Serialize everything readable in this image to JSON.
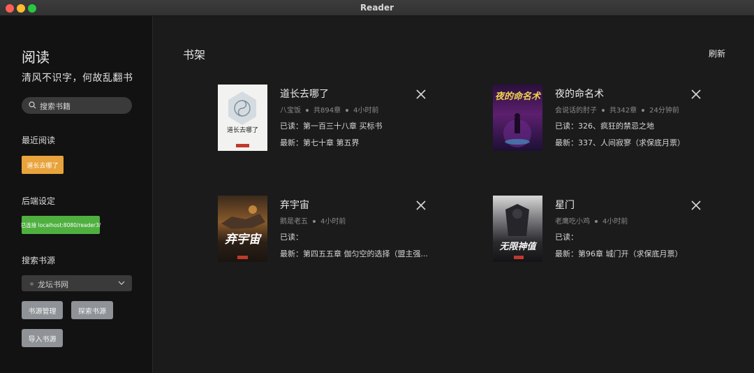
{
  "window": {
    "title": "Reader"
  },
  "sidebar": {
    "title": "阅读",
    "subtitle": "清风不识字，何故乱翻书",
    "search_placeholder": "搜索书籍",
    "recent_label": "最近阅读",
    "recent_book": "道长去哪了",
    "backend_label": "后端设定",
    "backend_status": "已连接 localhost:8080/reader3/",
    "source_label": "搜索书源",
    "source_selected": "龙坛书网",
    "btn_manage": "书源管理",
    "btn_explore": "探索书源",
    "btn_import": "导入书源"
  },
  "main": {
    "title": "书架",
    "refresh": "刷新",
    "books": [
      {
        "title": "道长去哪了",
        "author": "八宝饭",
        "chapters": "共894章",
        "updated": "4小时前",
        "read": "已读：第一百三十八章 买标书",
        "latest": "最新：第七十章 第五界",
        "cover_text": "道长去哪了"
      },
      {
        "title": "夜的命名术",
        "author": "会说话的肘子",
        "chapters": "共342章",
        "updated": "24分钟前",
        "read": "已读：326、疯狂的禁忌之地",
        "latest": "最新：337、人间寂寥（求保底月票）",
        "cover_text": "夜的命名术"
      },
      {
        "title": "弃宇宙",
        "author": "鹅是老五",
        "updated": "4小时前",
        "read": "已读：",
        "latest": "最新：第四五五章 伽匀空的选择（盟主强...",
        "cover_text": "弃宇宙"
      },
      {
        "title": "星门",
        "author": "老鹰吃小鸡",
        "updated": "4小时前",
        "read": "已读：",
        "latest": "最新：第96章 城门开（求保底月票）",
        "cover_text": "无限神值"
      }
    ]
  }
}
